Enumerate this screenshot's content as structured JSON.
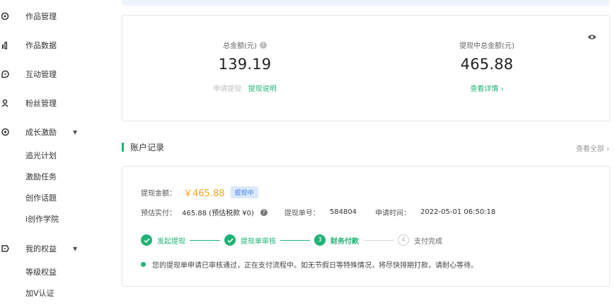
{
  "sidebar": {
    "items": [
      {
        "label": "作品管理"
      },
      {
        "label": "作品数据"
      },
      {
        "label": "互动管理"
      },
      {
        "label": "粉丝管理"
      },
      {
        "label": "成长激励",
        "expandable": true
      },
      {
        "label": "我的权益",
        "expandable": true
      }
    ],
    "growth_sub": [
      "追光计划",
      "激励任务",
      "创作话题",
      "i创作学院"
    ],
    "rights_sub": [
      "等级权益",
      "加V认证"
    ]
  },
  "summary": {
    "total_label": "总金额(元)",
    "total_value": "139.19",
    "withdraw_link": "申请提现",
    "explain_link": "提现说明",
    "pending_label": "提现中总金额(元)",
    "pending_value": "465.88",
    "detail_link": "查看详情 ›"
  },
  "section": {
    "title": "账户记录",
    "view_all": "查看全部 ›"
  },
  "record": {
    "amount_label": "提现金额：",
    "amount_value": "￥465.88",
    "status_badge": "提现中",
    "estimated_label": "预估实付：",
    "estimated_value": "465.88 (预估税款 ¥0)",
    "order_label": "提现单号：",
    "order_value": "584804",
    "time_label": "申请时间：",
    "time_value": "2022-05-01 06:50:18",
    "steps": [
      {
        "label": "发起提现",
        "state": "done"
      },
      {
        "label": "提现单审核",
        "state": "done"
      },
      {
        "label": "财务付款",
        "state": "active",
        "num": "3"
      },
      {
        "label": "支付完成",
        "state": "pending",
        "num": "4"
      }
    ],
    "notice": "您的提现单申请已审核通过，正在支付流程中。如无节假日等特殊情况，将尽快排期打款，请耐心等待。"
  },
  "colors": {
    "accent": "#1fb375",
    "amount": "#f5a623",
    "badge_bg": "#dbe8fb",
    "badge_text": "#3b7be6"
  }
}
